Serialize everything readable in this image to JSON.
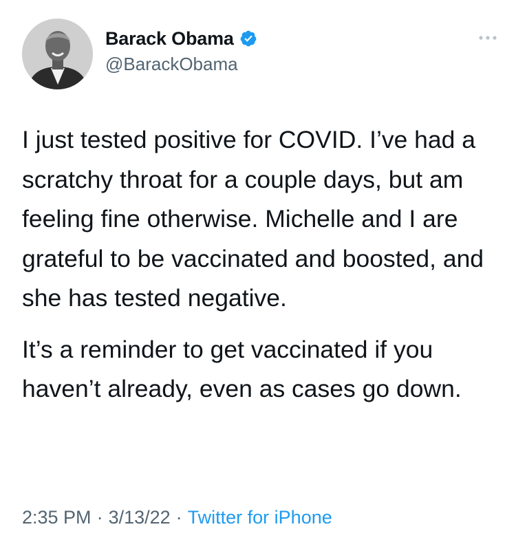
{
  "author": {
    "display_name": "Barack Obama",
    "handle": "@BarackObama",
    "verified": true,
    "verified_color": "#1d9bf0",
    "avatar": "profile-photo"
  },
  "tweet": {
    "paragraphs": [
      "I just tested positive for COVID. I’ve had a scratchy throat for a couple days, but am feeling fine otherwise. Michelle and I are grateful to be vaccinated and boosted, and she has tested negative.",
      "It’s a reminder to get vaccinated if you haven’t already, even as cases go down."
    ]
  },
  "meta": {
    "time": "2:35 PM",
    "separator": "·",
    "date": "3/13/22",
    "source": "Twitter for iPhone",
    "source_color": "#1d9bf0"
  },
  "icons": {
    "more": "more-options-icon",
    "verified": "verified-badge-icon"
  }
}
